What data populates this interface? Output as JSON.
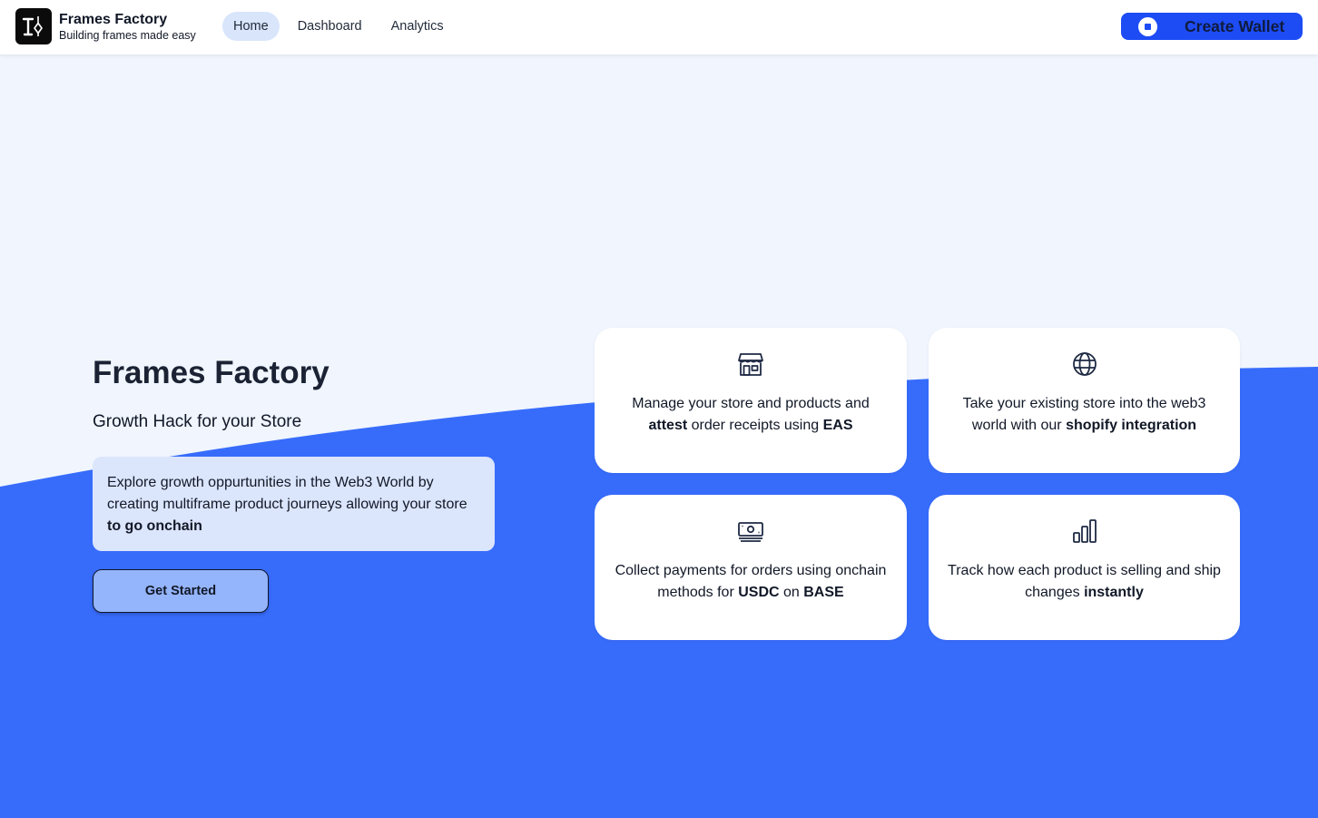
{
  "header": {
    "brand_name": "Frames Factory",
    "brand_tagline": "Building frames made easy",
    "nav": [
      {
        "label": "Home",
        "active": true
      },
      {
        "label": "Dashboard",
        "active": false
      },
      {
        "label": "Analytics",
        "active": false
      }
    ],
    "wallet_button": "Create Wallet"
  },
  "hero": {
    "title": "Frames Factory",
    "subtitle": "Growth Hack for your Store",
    "callout": {
      "text": "Explore growth oppurtunities in the Web3 World by creating multiframe product journeys allowing your store ",
      "bold": "to go onchain"
    },
    "cta": "Get Started"
  },
  "features": [
    {
      "icon": "store-icon",
      "parts": [
        "Manage your store and products and ",
        "attest",
        " order receipts using ",
        "EAS",
        ""
      ]
    },
    {
      "icon": "globe-icon",
      "parts": [
        "Take your existing store into the web3 world with our ",
        "shopify integration",
        ""
      ]
    },
    {
      "icon": "cash-icon",
      "parts": [
        "Collect payments for orders using onchain methods for ",
        "USDC",
        " on ",
        "BASE",
        ""
      ]
    },
    {
      "icon": "bar-chart-icon",
      "parts": [
        "Track how each product is selling and ship changes ",
        "instantly",
        ""
      ]
    }
  ],
  "colors": {
    "accent": "#1d4cf5",
    "wave": "#376cfb",
    "page_bg": "#f0f5fe",
    "nav_active": "#d8e5fb",
    "callout_bg": "#dbe5fc",
    "cta_bg": "#94b4fb"
  }
}
